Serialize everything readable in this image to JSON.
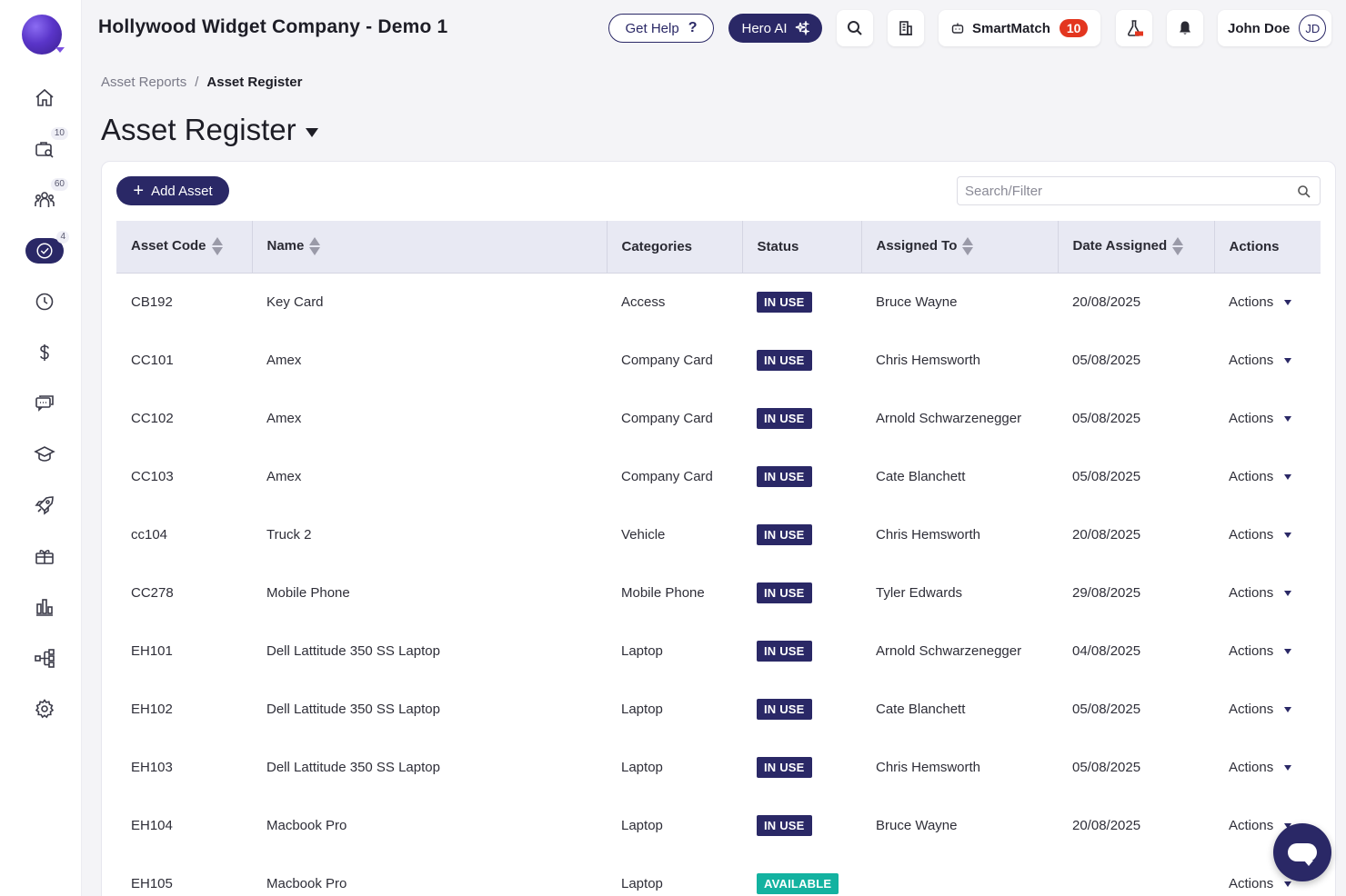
{
  "header": {
    "app_title": "Hollywood Widget Company - Demo 1",
    "help_label": "Get Help",
    "help_icon": "?",
    "hero_label": "Hero AI",
    "smartmatch_label": "SmartMatch",
    "smartmatch_count": "10",
    "user_name": "John Doe",
    "user_initials": "JD",
    "accent_color": "#2a2866"
  },
  "sidebar": {
    "items": [
      {
        "icon": "home-icon",
        "badge": ""
      },
      {
        "icon": "briefcase-search-icon",
        "badge": "10"
      },
      {
        "icon": "people-icon",
        "badge": "60"
      },
      {
        "icon": "check-circle-icon",
        "badge": "4"
      },
      {
        "icon": "clock-icon",
        "badge": ""
      },
      {
        "icon": "dollar-icon",
        "badge": ""
      },
      {
        "icon": "chat-icon",
        "badge": ""
      },
      {
        "icon": "graduation-cap-icon",
        "badge": ""
      },
      {
        "icon": "rocket-icon",
        "badge": ""
      },
      {
        "icon": "gift-icon",
        "badge": ""
      },
      {
        "icon": "bar-chart-icon",
        "badge": ""
      },
      {
        "icon": "org-chart-icon",
        "badge": ""
      },
      {
        "icon": "gear-icon",
        "badge": ""
      }
    ]
  },
  "breadcrumb": {
    "parent": "Asset Reports",
    "separator": "/",
    "current": "Asset Register"
  },
  "page": {
    "title": "Asset Register",
    "add_button": "Add Asset",
    "search_placeholder": "Search/Filter"
  },
  "table": {
    "columns": [
      "Asset Code",
      "Name",
      "Categories",
      "Status",
      "Assigned To",
      "Date Assigned",
      "Actions"
    ],
    "rows": [
      {
        "code": "CB192",
        "name": "Key Card",
        "category": "Access",
        "status": "IN USE",
        "assigned": "Bruce Wayne",
        "date": "20/08/2025",
        "actions": "Actions"
      },
      {
        "code": "CC101",
        "name": "Amex",
        "category": "Company Card",
        "status": "IN USE",
        "assigned": "Chris Hemsworth",
        "date": "05/08/2025",
        "actions": "Actions"
      },
      {
        "code": "CC102",
        "name": "Amex",
        "category": "Company Card",
        "status": "IN USE",
        "assigned": "Arnold Schwarzenegger",
        "date": "05/08/2025",
        "actions": "Actions"
      },
      {
        "code": "CC103",
        "name": "Amex",
        "category": "Company Card",
        "status": "IN USE",
        "assigned": "Cate Blanchett",
        "date": "05/08/2025",
        "actions": "Actions"
      },
      {
        "code": "cc104",
        "name": "Truck 2",
        "category": "Vehicle",
        "status": "IN USE",
        "assigned": "Chris Hemsworth",
        "date": "20/08/2025",
        "actions": "Actions"
      },
      {
        "code": "CC278",
        "name": "Mobile Phone",
        "category": "Mobile Phone",
        "status": "IN USE",
        "assigned": "Tyler Edwards",
        "date": "29/08/2025",
        "actions": "Actions"
      },
      {
        "code": "EH101",
        "name": "Dell Lattitude 350 SS Laptop",
        "category": "Laptop",
        "status": "IN USE",
        "assigned": "Arnold Schwarzenegger",
        "date": "04/08/2025",
        "actions": "Actions"
      },
      {
        "code": "EH102",
        "name": "Dell Lattitude 350 SS Laptop",
        "category": "Laptop",
        "status": "IN USE",
        "assigned": "Cate Blanchett",
        "date": "05/08/2025",
        "actions": "Actions"
      },
      {
        "code": "EH103",
        "name": "Dell Lattitude 350 SS Laptop",
        "category": "Laptop",
        "status": "IN USE",
        "assigned": "Chris Hemsworth",
        "date": "05/08/2025",
        "actions": "Actions"
      },
      {
        "code": "EH104",
        "name": "Macbook Pro",
        "category": "Laptop",
        "status": "IN USE",
        "assigned": "Bruce Wayne",
        "date": "20/08/2025",
        "actions": "Actions"
      },
      {
        "code": "EH105",
        "name": "Macbook Pro",
        "category": "Laptop",
        "status": "AVAILABLE",
        "assigned": "",
        "date": "",
        "actions": "Actions"
      }
    ]
  },
  "colors": {
    "in_use": "#2a2866",
    "available": "#13b2a0",
    "notification": "#e3361f"
  }
}
